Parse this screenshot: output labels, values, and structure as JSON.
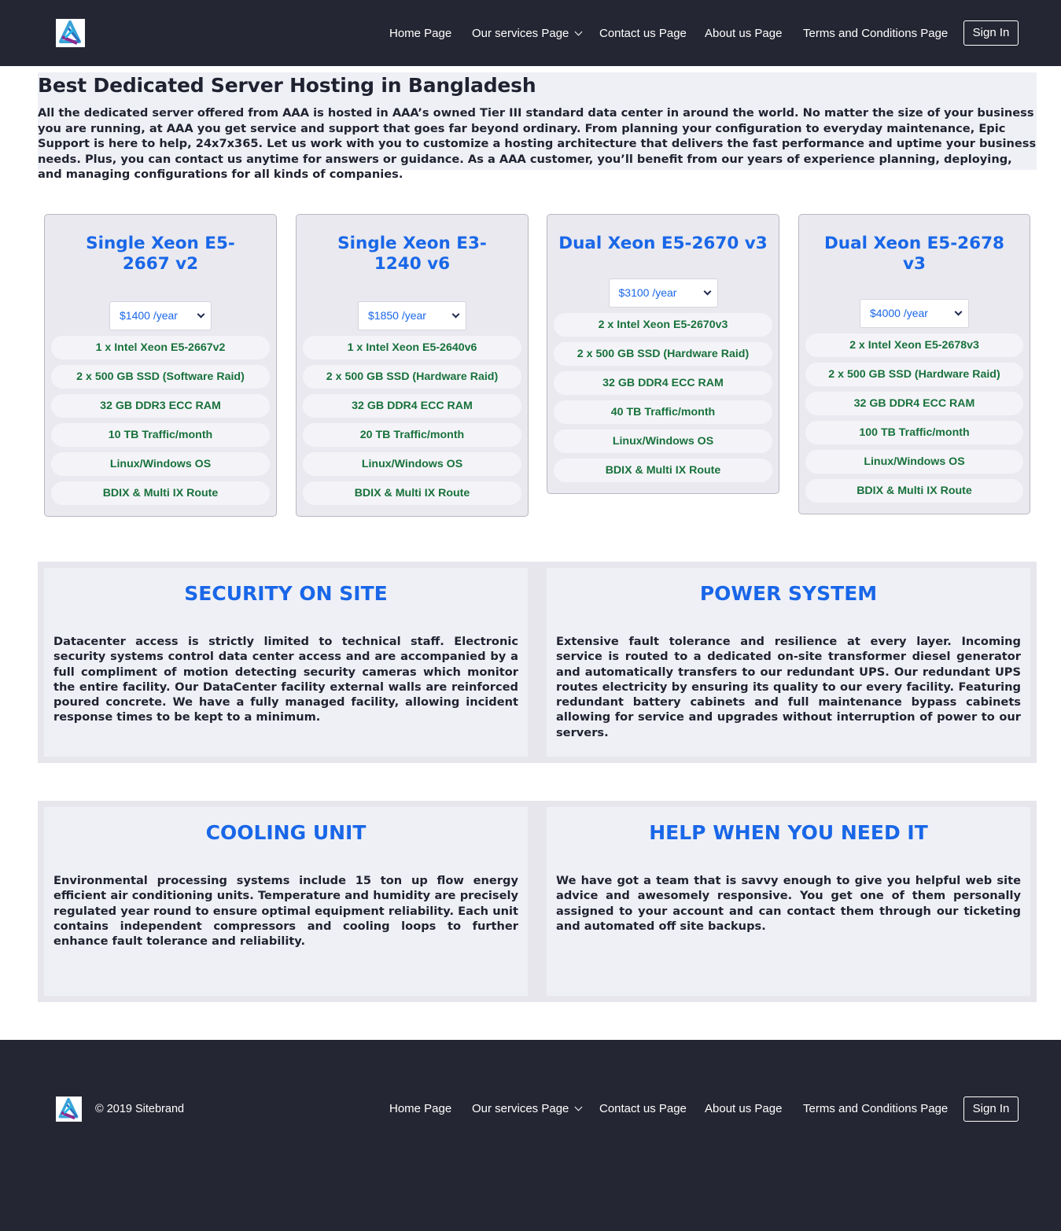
{
  "nav": {
    "home": "Home Page",
    "services": "Our services Page",
    "contact": "Contact us Page",
    "about": "About us Page",
    "terms": "Terms and Conditions Page",
    "signin": "Sign In"
  },
  "intro": {
    "title": "Best Dedicated Server Hosting in Bangladesh",
    "body": "All the dedicated server offered from AAA is hosted in AAA’s owned Tier III standard data center in around the world. No matter the size of your business you are running, at AAA you get service and support that goes far beyond ordinary. From planning your configuration to everyday maintenance, Epic Support is here to help, 24x7x365. Let us work with you to customize a hosting architecture that delivers the fast performance and uptime your business needs. Plus, you can contact us anytime for answers or guidance. As a AAA customer, you’ll benefit from our years of experience planning, deploying, and managing configurations for all kinds of companies."
  },
  "plans": [
    {
      "title": "Single Xeon E5-2667 v2",
      "price": "$1400 /year",
      "features": [
        "1 x Intel Xeon E5-2667v2",
        "2 x 500 GB SSD (Software Raid)",
        "32 GB DDR3 ECC RAM",
        "10 TB Traffic/month",
        "Linux/Windows OS",
        "BDIX & Multi IX Route"
      ]
    },
    {
      "title": "Single Xeon E3-1240 v6",
      "price": "$1850 /year",
      "features": [
        "1 x Intel Xeon E5-2640v6",
        "2 x 500 GB SSD (Hardware Raid)",
        "32 GB DDR4 ECC RAM",
        "20 TB Traffic/month",
        "Linux/Windows OS",
        "BDIX & Multi IX Route"
      ]
    },
    {
      "title": "Dual Xeon E5-2670 v3",
      "price": "$3100 /year",
      "features": [
        "2 x Intel Xeon E5-2670v3",
        "2 x 500 GB SSD (Hardware Raid)",
        "32 GB DDR4 ECC RAM",
        "40 TB Traffic/month",
        "Linux/Windows OS",
        "BDIX & Multi IX Route"
      ]
    },
    {
      "title": "Dual Xeon E5-2678 v3",
      "price": "$4000 /year",
      "features": [
        "2 x Intel Xeon E5-2678v3",
        "2 x 500 GB SSD (Hardware Raid)",
        "32 GB DDR4 ECC RAM",
        "100 TB Traffic/month",
        "Linux/Windows OS",
        "BDIX & Multi IX Route"
      ]
    }
  ],
  "info": [
    {
      "title": "SECURITY ON SITE",
      "body": "Datacenter access is strictly limited to technical staff. Electronic security systems control data center access and are accompanied by a full compliment of motion detecting security cameras which monitor the entire facility. Our DataCenter facility external walls are reinforced poured concrete. We have a fully managed facility, allowing incident response times to be kept to a minimum."
    },
    {
      "title": "POWER SYSTEM",
      "body": "Extensive fault tolerance and resilience at every layer. Incoming service is routed to a dedicated on-site transformer diesel generator and automatically transfers to our redundant UPS. Our redundant UPS routes electricity by ensuring its quality to our every facility. Featuring redundant battery cabinets and full maintenance bypass cabinets allowing for service and upgrades without interruption of power to our servers."
    },
    {
      "title": "COOLING UNIT",
      "body": "Environmental processing systems include 15 ton up flow energy efficient air conditioning units. Temperature and humidity are precisely regulated year round to ensure optimal equipment reliability. Each unit contains independent compressors and cooling loops to further enhance fault tolerance and reliability."
    },
    {
      "title": "HELP WHEN YOU NEED IT",
      "body": "We have got a team that is savvy enough to give you helpful web site advice and awesomely responsive. You get one of them personally assigned to your account and can contact them through our ticketing and automated off site backups."
    }
  ],
  "footer": {
    "copyright": "© 2019 Sitebrand"
  },
  "icons": {
    "logo": "brand-logo-icon",
    "dropdown": "chevron-down-icon"
  },
  "colors": {
    "nav_bg": "#252633",
    "accent": "#1967e8",
    "feature_text": "#18713b"
  }
}
